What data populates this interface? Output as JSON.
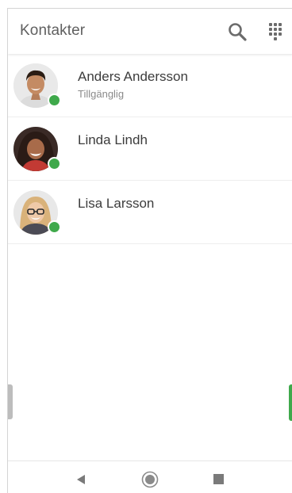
{
  "header": {
    "title": "Kontakter",
    "actions": [
      {
        "icon": "search-icon"
      },
      {
        "icon": "dialpad-icon"
      }
    ]
  },
  "contacts": [
    {
      "name": "Anders Andersson",
      "status": "Tillgänglig",
      "online": true
    },
    {
      "name": "Linda Lindh",
      "status": "",
      "online": true
    },
    {
      "name": "Lisa Larsson",
      "status": "",
      "online": true
    }
  ],
  "navbar": {
    "icons": [
      "back-icon",
      "home-icon",
      "recents-icon"
    ]
  },
  "colors": {
    "accent": "#3fa94b",
    "title_text": "#606060",
    "name_text": "#3c3c3c",
    "status_text": "#8a8a8a"
  }
}
